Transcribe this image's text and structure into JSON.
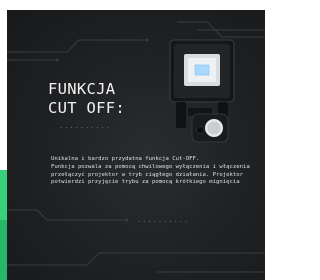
{
  "headline": {
    "line1": "FUNKCJA",
    "line2": "CUT OFF:"
  },
  "decor": {
    "dots_top": "··········",
    "dots_bottom": "··········"
  },
  "description": {
    "paragraph1": "Unikalna i bardzo przydatna funkcja Cut-OFF.",
    "paragraph2": "Funkcja pozwala za pomocą chwilowego wyłączenia i włączenia przełączyć projektor w tryb ciągłego działania. Projektor potwierdzi przyjęcie trybu za pomocą krótkiego mignięcia"
  },
  "product": {
    "icon": "floodlight-with-motion-sensor-icon"
  },
  "colors": {
    "accent": "#37d07d",
    "panel": "#1e2022",
    "text": "#f2f2f2"
  }
}
